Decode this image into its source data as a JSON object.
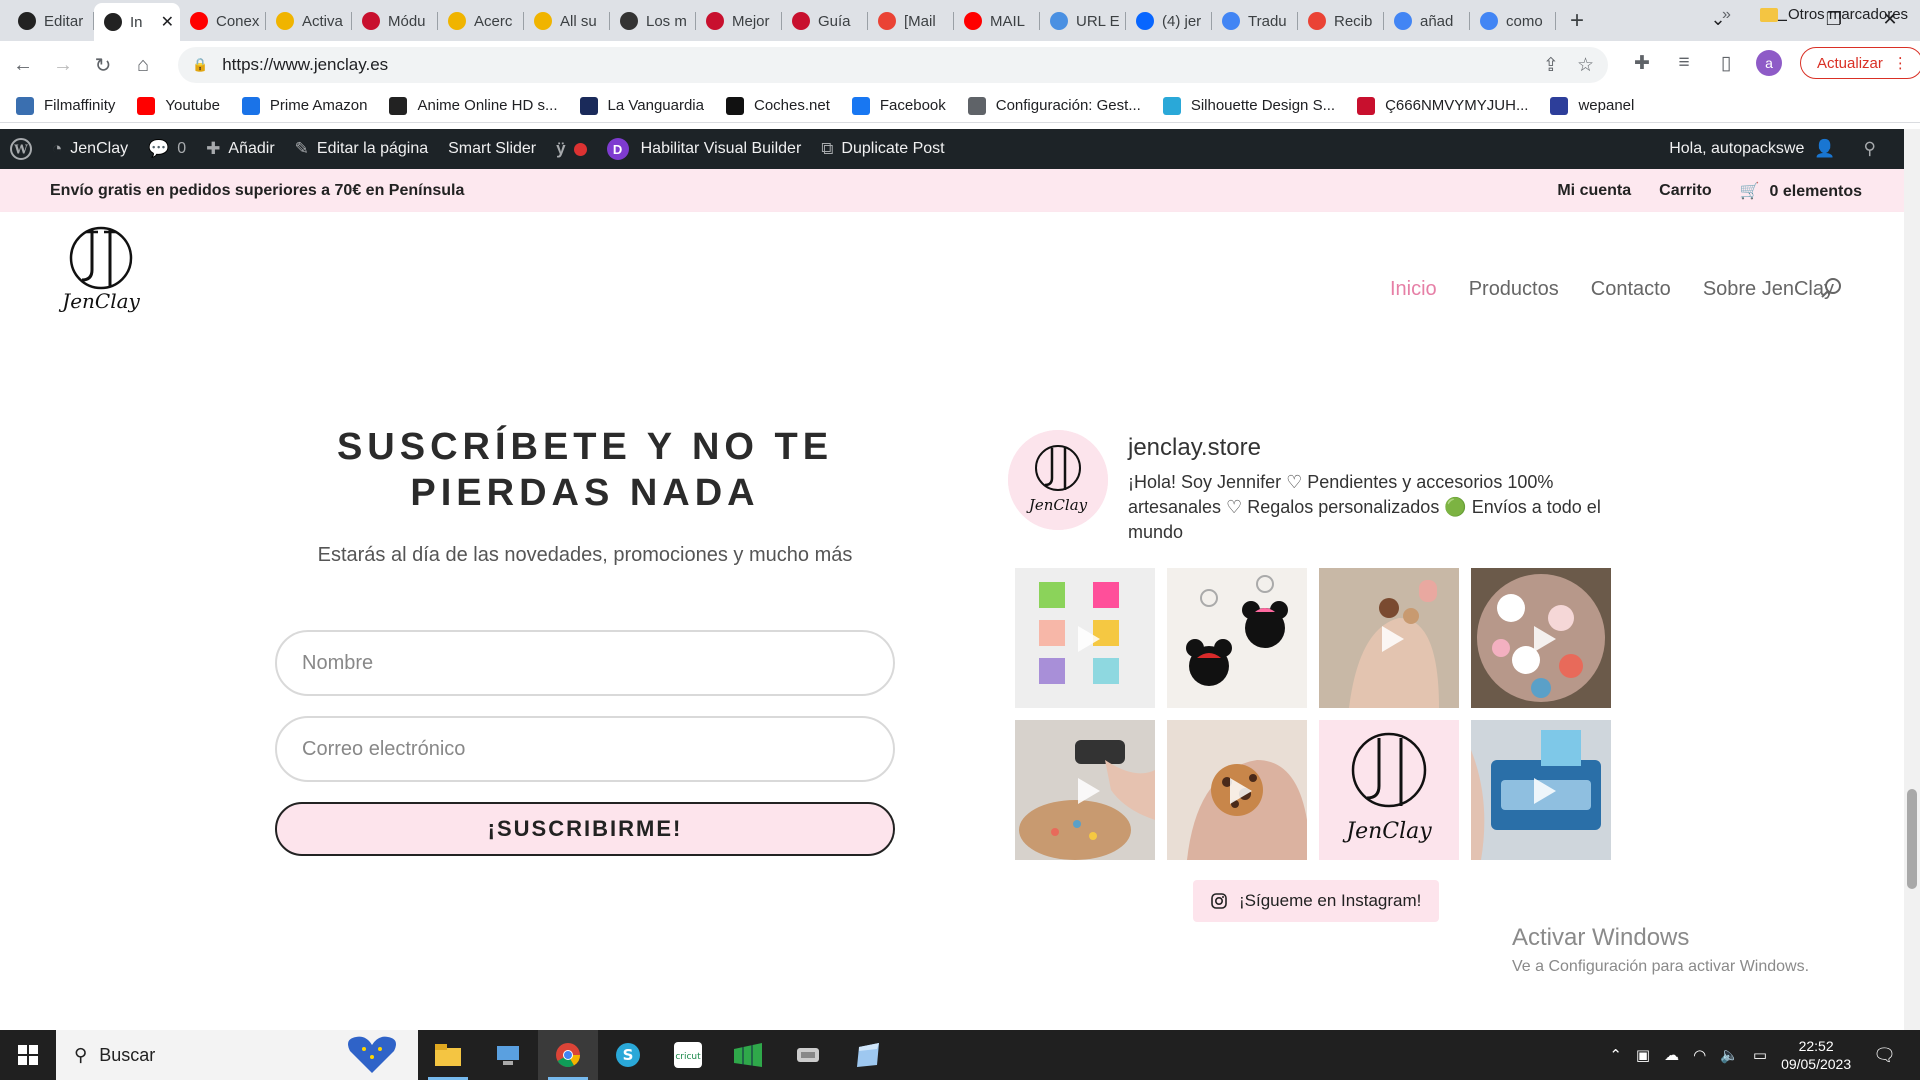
{
  "browser": {
    "tabs": [
      {
        "label": "Editar",
        "color": "#222"
      },
      {
        "label": "In",
        "color": "#222",
        "active": true
      },
      {
        "label": "Conexi",
        "color": "#ff0000"
      },
      {
        "label": "Activa",
        "color": "#f0b400"
      },
      {
        "label": "Módu",
        "color": "#c8102e"
      },
      {
        "label": "Acerc",
        "color": "#f0b400"
      },
      {
        "label": "All su",
        "color": "#f0b400"
      },
      {
        "label": "Los m",
        "color": "#333"
      },
      {
        "label": "Mejor",
        "color": "#c8102e"
      },
      {
        "label": "Guía",
        "color": "#c8102e"
      },
      {
        "label": "[Mail",
        "color": "#ea4335"
      },
      {
        "label": "MAIL",
        "color": "#ff0000"
      },
      {
        "label": "URL E",
        "color": "#4a90e2"
      },
      {
        "label": "(4) jer",
        "color": "#0866ff"
      },
      {
        "label": "Tradu",
        "color": "#4285f4"
      },
      {
        "label": "Recib",
        "color": "#ea4335"
      },
      {
        "label": "añad",
        "color": "#4285f4"
      },
      {
        "label": "como",
        "color": "#4285f4"
      }
    ],
    "url": "https://www.jenclay.es",
    "update_label": "Actualizar",
    "profile_initial": "a",
    "bookmarks": [
      {
        "label": "Filmaffinity",
        "color": "#3a6fb0"
      },
      {
        "label": "Youtube",
        "color": "#ff0000"
      },
      {
        "label": "Prime Amazon",
        "color": "#1a73e8"
      },
      {
        "label": "Anime Online HD s...",
        "color": "#222"
      },
      {
        "label": "La Vanguardia",
        "color": "#1a2a5a"
      },
      {
        "label": "Coches.net",
        "color": "#111"
      },
      {
        "label": "Facebook",
        "color": "#1877f2"
      },
      {
        "label": "Configuración: Gest...",
        "color": "#5f6368"
      },
      {
        "label": "Silhouette Design S...",
        "color": "#2aa8d8"
      },
      {
        "label": "Ç666NMVYMYJUH...",
        "color": "#c8102e"
      },
      {
        "label": "wepanel",
        "color": "#2d3e9a"
      }
    ],
    "bookmarks_more": "»",
    "other_bookmarks": "Otros marcadores"
  },
  "adminbar": {
    "site_name": "JenClay",
    "comments_count": "0",
    "add_label": "Añadir",
    "edit_label": "Editar la página",
    "smart_slider": "Smart Slider",
    "visual_builder": "Habilitar Visual Builder",
    "duplicate_post": "Duplicate Post",
    "greeting": "Hola, autopackswe"
  },
  "site": {
    "promo": "Envío gratis en pedidos superiores a 70€ en Península",
    "my_account": "Mi cuenta",
    "cart": "Carrito",
    "cart_items": "0 elementos",
    "logo_text": "JenClay",
    "nav": [
      "Inicio",
      "Productos",
      "Contacto",
      "Sobre JenClay"
    ],
    "accent": "#e67fa6",
    "topbar_bg": "#fde8ef"
  },
  "subscribe": {
    "title": "SUSCRÍBETE Y NO TE PIERDAS NADA",
    "subtitle": "Estarás al día de las novedades, promociones y mucho más",
    "name_placeholder": "Nombre",
    "email_placeholder": "Correo electrónico",
    "button": "¡SUSCRIBIRME!"
  },
  "instagram": {
    "username": "jenclay.store",
    "bio": "¡Hola! Soy Jennifer ♡ Pendientes y accesorios 100% artesanales ♡ Regalos personalizados 🟢 Envíos a todo el mundo",
    "follow_button": "¡Sígueme en Instagram!",
    "posts": [
      {
        "type": "video",
        "subject": "colored clay squares"
      },
      {
        "type": "photo",
        "subject": "minnie keychains"
      },
      {
        "type": "video",
        "subject": "hand with earrings"
      },
      {
        "type": "video",
        "subject": "flower clay pieces bowl"
      },
      {
        "type": "video",
        "subject": "clay tools"
      },
      {
        "type": "video",
        "subject": "leopard clay"
      },
      {
        "type": "photo",
        "subject": "jenclay logo"
      },
      {
        "type": "video",
        "subject": "pasta machine"
      }
    ]
  },
  "watermark": {
    "line1": "Activar Windows",
    "line2": "Ve a Configuración para activar Windows."
  },
  "taskbar": {
    "search_placeholder": "Buscar",
    "time": "22:52",
    "date": "09/05/2023"
  }
}
